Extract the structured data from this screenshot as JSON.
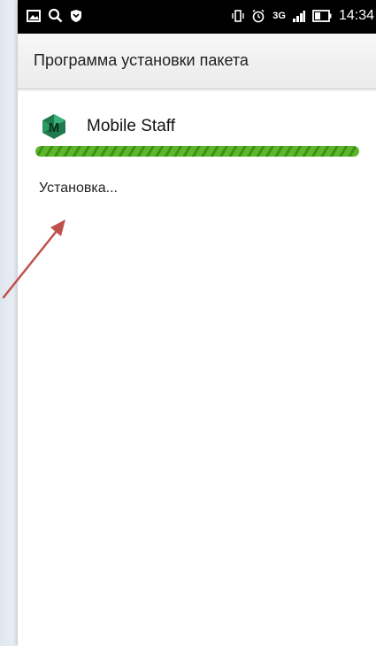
{
  "status_bar": {
    "time": "14:34",
    "network": "3G",
    "icons_left": [
      "gallery-icon",
      "search-icon",
      "shield-icon"
    ],
    "icons_right": [
      "vibrate-icon",
      "alarm-icon",
      "signal-icon",
      "battery-icon"
    ]
  },
  "header": {
    "title": "Программа установки пакета"
  },
  "app": {
    "name": "Mobile Staff",
    "icon_letter": "M",
    "icon_color": "#2e8b57"
  },
  "progress": {
    "fraction": 1.0,
    "color": "#5cb82a"
  },
  "status": {
    "text": "Установка..."
  },
  "annotation": {
    "arrow_color": "#c0504d"
  }
}
